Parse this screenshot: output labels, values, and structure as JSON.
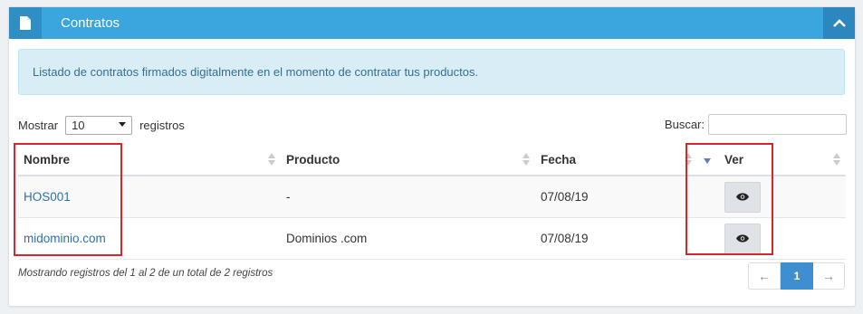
{
  "panel": {
    "title": "Contratos",
    "header_icon": "file-icon",
    "collapse_icon": "chevron-up-icon"
  },
  "info": {
    "text": "Listado de contratos firmados digitalmente en el momento de contratar tus productos."
  },
  "length": {
    "prefix": "Mostrar",
    "value": "10",
    "suffix": "registros"
  },
  "search": {
    "label": "Buscar:",
    "value": ""
  },
  "table": {
    "headers": [
      "Nombre",
      "Producto",
      "Fecha",
      "Ver"
    ],
    "rows": [
      {
        "nombre": "HOS001",
        "producto": "-",
        "fecha": "07/08/19",
        "ver_icon": "eye-icon"
      },
      {
        "nombre": "midominio.com",
        "producto": "Dominios .com",
        "fecha": "07/08/19",
        "ver_icon": "eye-icon"
      }
    ]
  },
  "footer": {
    "info": "Mostrando registros del 1 al 2 de un total de 2 registros"
  },
  "pagination": {
    "prev": "←",
    "current": "1",
    "next": "→"
  },
  "colors": {
    "header": "#3aa6dd",
    "header_dark": "#2b87bd",
    "info_bg": "#d9edf7",
    "link": "#2f6fad",
    "highlight": "#d9232d",
    "active_page": "#3f8fd0"
  }
}
